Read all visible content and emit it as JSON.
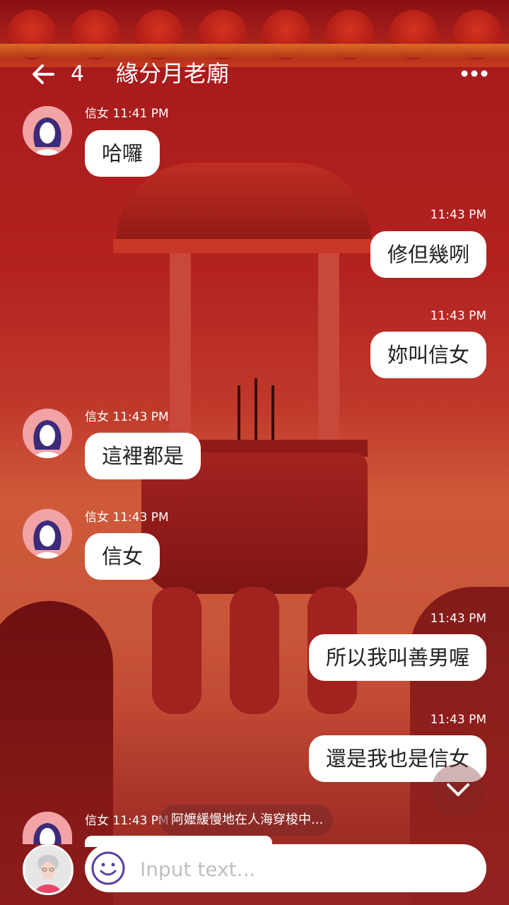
{
  "header": {
    "unread_count": "4",
    "title": "緣分月老廟",
    "back_icon": "arrow-left-icon",
    "more_icon": "more-dots-icon"
  },
  "messages": [
    {
      "side": "left",
      "sender": "信女",
      "time": "11:41 PM",
      "text": "哈囉"
    },
    {
      "side": "right",
      "time": "11:43 PM",
      "text": "修但幾咧"
    },
    {
      "side": "right",
      "time": "11:43 PM",
      "text": "妳叫信女"
    },
    {
      "side": "left",
      "sender": "信女",
      "time": "11:43 PM",
      "text": "這裡都是"
    },
    {
      "side": "left",
      "sender": "信女",
      "time": "11:43 PM",
      "text": "信女"
    },
    {
      "side": "right",
      "time": "11:43 PM",
      "text": "所以我叫善男喔"
    },
    {
      "side": "right",
      "time": "11:43 PM",
      "text": "還是我也是信女"
    },
    {
      "side": "left",
      "sender": "信女",
      "time": "11:43 PM",
      "text": ""
    }
  ],
  "typing_indicator": "阿嬤緩慢地在人海穿梭中...",
  "input": {
    "placeholder": "Input text...",
    "value": "",
    "emoji_icon": "smiley-icon"
  },
  "colors": {
    "background_primary": "#b32220",
    "bubble": "#ffffff",
    "accent_purple": "#5b3fa0"
  }
}
